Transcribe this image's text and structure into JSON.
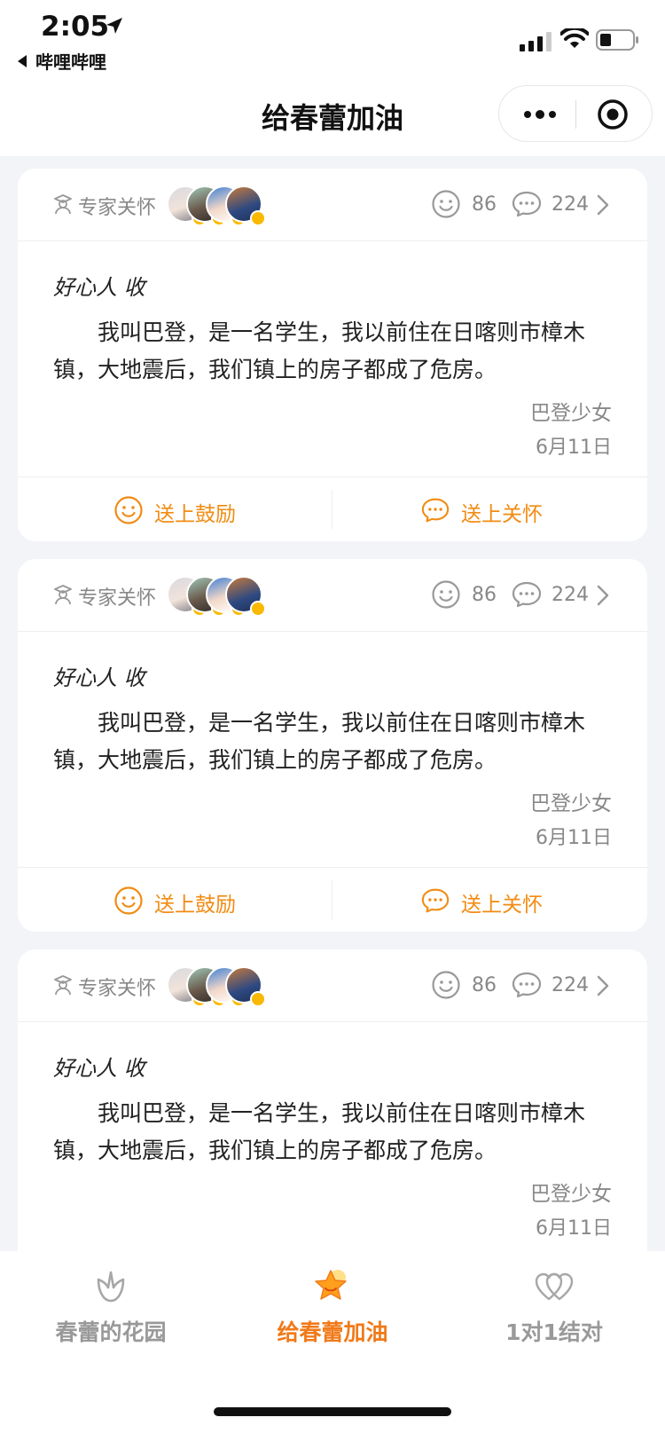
{
  "status_bar": {
    "time": "2:05",
    "back_app": "哔哩哔哩"
  },
  "nav": {
    "title": "给春蕾加油"
  },
  "colors": {
    "accent_orange": "#F28B12",
    "tab_active": "#F07A1A",
    "avatar_badge": "#F9B900",
    "muted_text": "#888888"
  },
  "cards": [
    {
      "expert_label": "专家关怀",
      "likes": "86",
      "comments": "224",
      "greeting": "好心人 收",
      "letter": "我叫巴登，是一名学生，我以前住在日喀则市樟木镇，大地震后，我们镇上的房子都成了危房。",
      "signer": "巴登少女",
      "date": "6月11日",
      "encourage_label": "送上鼓励",
      "care_label": "送上关怀"
    },
    {
      "expert_label": "专家关怀",
      "likes": "86",
      "comments": "224",
      "greeting": "好心人 收",
      "letter": "我叫巴登，是一名学生，我以前住在日喀则市樟木镇，大地震后，我们镇上的房子都成了危房。",
      "signer": "巴登少女",
      "date": "6月11日",
      "encourage_label": "送上鼓励",
      "care_label": "送上关怀"
    },
    {
      "expert_label": "专家关怀",
      "likes": "86",
      "comments": "224",
      "greeting": "好心人 收",
      "letter": "我叫巴登，是一名学生，我以前住在日喀则市樟木镇，大地震后，我们镇上的房子都成了危房。",
      "signer": "巴登少女",
      "date": "6月11日"
    }
  ],
  "tabbar": {
    "tabs": [
      {
        "label": "春蕾的花园",
        "icon": "flower-icon"
      },
      {
        "label": "给春蕾加油",
        "icon": "star-icon",
        "active": true
      },
      {
        "label": "1对1结对",
        "icon": "hearts-icon"
      }
    ]
  }
}
